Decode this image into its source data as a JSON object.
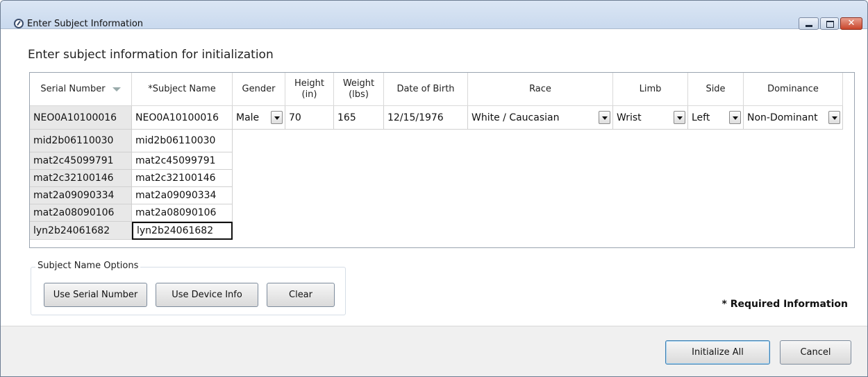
{
  "window": {
    "title": "Enter Subject Information",
    "close_glyph": "✕"
  },
  "heading": "Enter subject information for initialization",
  "table": {
    "columns": [
      "Serial Number",
      "*Subject Name",
      "Gender",
      "Height (in)",
      "Weight (lbs)",
      "Date of Birth",
      "Race",
      "Limb",
      "Side",
      "Dominance"
    ],
    "first_row": {
      "serial": "NEO0A10100016",
      "name": "NEO0A10100016",
      "gender": "Male",
      "height": "70",
      "weight": "165",
      "dob": "12/15/1976",
      "race": "White / Caucasian",
      "limb": "Wrist",
      "side": "Left",
      "dominance": "Non-Dominant"
    },
    "rows": [
      {
        "serial": "mid2b06110030",
        "name": "mid2b06110030"
      },
      {
        "serial": "mat2c45099791",
        "name": "mat2c45099791"
      },
      {
        "serial": "mat2c32100146",
        "name": "mat2c32100146"
      },
      {
        "serial": "mat2a09090334",
        "name": "mat2a09090334"
      },
      {
        "serial": "mat2a08090106",
        "name": "mat2a08090106"
      },
      {
        "serial": "lyn2b24061682",
        "name": "lyn2b24061682"
      }
    ]
  },
  "options": {
    "group_label": "Subject Name Options",
    "use_serial": "Use Serial Number",
    "use_device": "Use Device Info",
    "clear": "Clear"
  },
  "required_note": "* Required Information",
  "footer": {
    "initialize": "Initialize All",
    "cancel": "Cancel"
  }
}
